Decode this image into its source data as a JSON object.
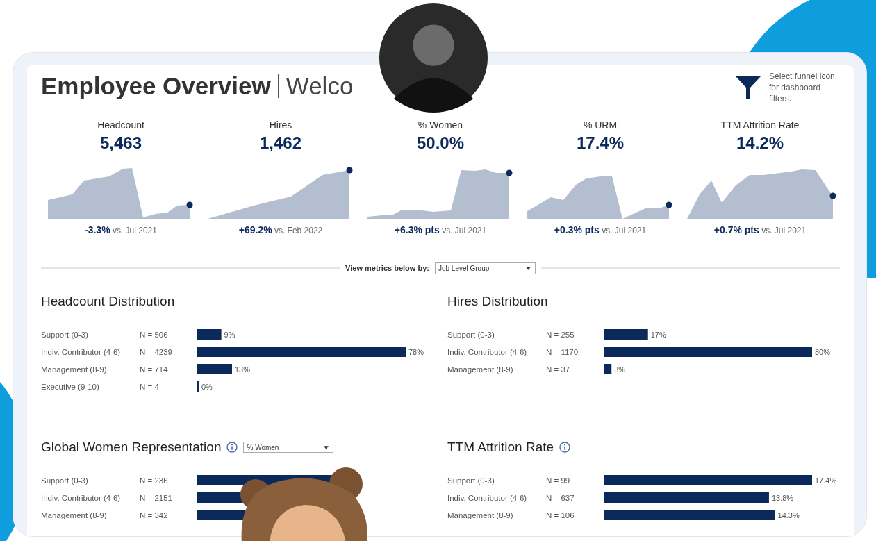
{
  "header": {
    "title": "Employee Overview",
    "subtitle": "Welco",
    "filter_hint": "Select funnel icon for dashboard filters."
  },
  "kpis": [
    {
      "label": "Headcount",
      "value": "5,463",
      "change": "-3.3%",
      "comparison": "vs. Jul 2021"
    },
    {
      "label": "Hires",
      "value": "1,462",
      "change": "+69.2%",
      "comparison": "vs. Feb 2022"
    },
    {
      "label": "% Women",
      "value": "50.0%",
      "change": "+6.3% pts",
      "comparison": "vs. Jul 2021"
    },
    {
      "label": "% URM",
      "value": "17.4%",
      "change": "+0.3% pts",
      "comparison": "vs. Jul 2021"
    },
    {
      "label": "TTM Attrition Rate",
      "value": "14.2%",
      "change": "+0.7% pts",
      "comparison": "vs. Jul 2021"
    }
  ],
  "metric_selector": {
    "label": "View metrics below by:",
    "value": "Job Level Group"
  },
  "panels": [
    {
      "title": "Headcount Distribution",
      "info_icon": false,
      "counts": [
        "N = 506",
        "N = 4239",
        "N = 714",
        "N = 4"
      ],
      "chart_data": {
        "type": "bar",
        "orientation": "horizontal",
        "categories": [
          "Support (0-3)",
          "Indiv. Contributor (4-6)",
          "Management (8-9)",
          "Executive (9-10)"
        ],
        "values": [
          9,
          78,
          13,
          0
        ],
        "value_labels": [
          "9%",
          "78%",
          "13%",
          "0%"
        ]
      }
    },
    {
      "title": "Hires Distribution",
      "info_icon": false,
      "counts": [
        "N = 255",
        "N = 1170",
        "N = 37"
      ],
      "chart_data": {
        "type": "bar",
        "orientation": "horizontal",
        "categories": [
          "Support (0-3)",
          "Indiv. Contributor (4-6)",
          "Management (8-9)"
        ],
        "values": [
          17,
          80,
          3
        ],
        "value_labels": [
          "17%",
          "80%",
          "3%"
        ]
      }
    },
    {
      "title": "Global Women Representation",
      "info_icon": true,
      "dropdown": "% Women",
      "counts": [
        "N = 236",
        "N = 2151",
        "N = 342"
      ],
      "categories": [
        "Support (0-3)",
        "Indiv. Contributor (4-6)",
        "Management (8-9)"
      ]
    },
    {
      "title": "TTM Attrition Rate",
      "info_icon": true,
      "counts": [
        "N = 99",
        "N = 637",
        "N = 106"
      ],
      "chart_data": {
        "type": "bar",
        "orientation": "horizontal",
        "categories": [
          "Support (0-3)",
          "Indiv. Contributor (4-6)",
          "Management (8-9)"
        ],
        "values": [
          17.4,
          13.8,
          14.3
        ],
        "value_labels": [
          "17.4%",
          "13.8%",
          "14.3%"
        ]
      }
    }
  ]
}
